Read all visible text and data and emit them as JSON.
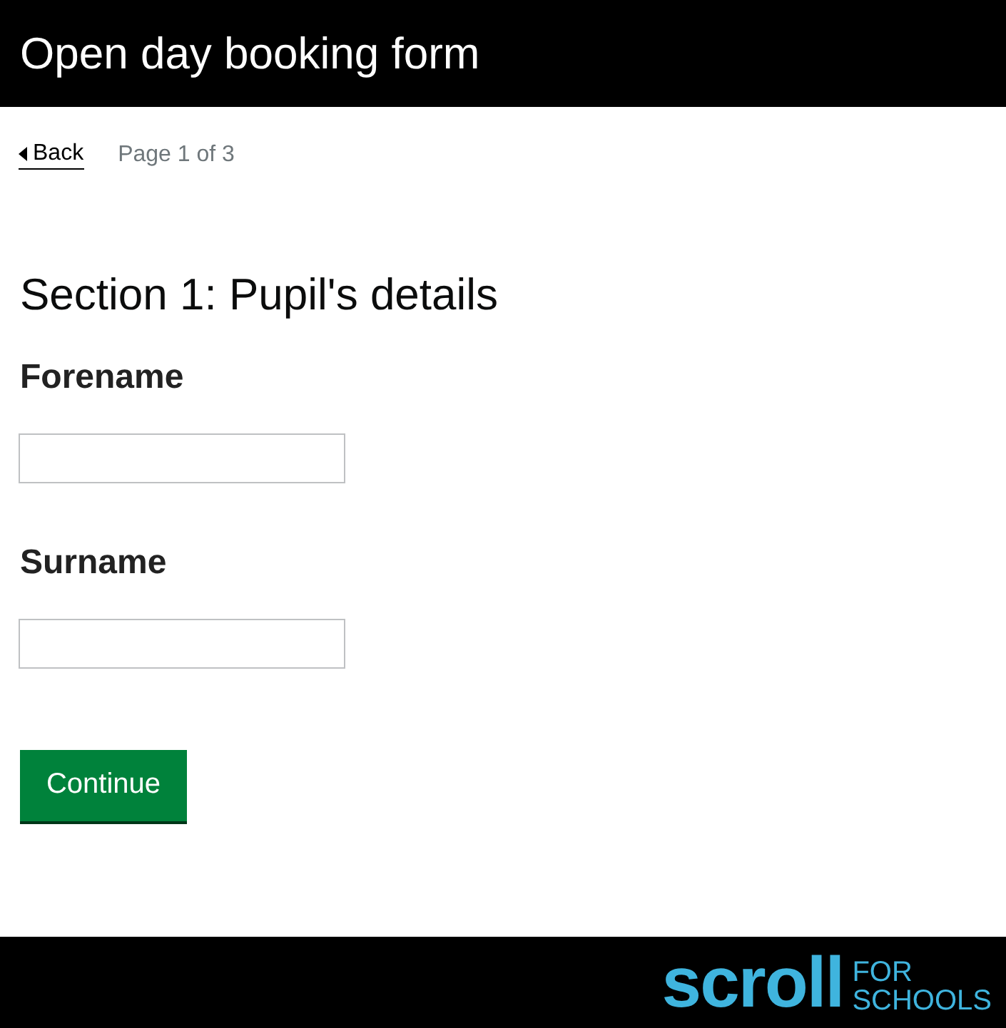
{
  "header": {
    "title": "Open day booking form"
  },
  "nav": {
    "back": "Back",
    "page": "Page 1 of 3"
  },
  "section_title": "Section 1: Pupil's details",
  "fields": [
    {
      "label": "Forename"
    },
    {
      "label": "Surname"
    }
  ],
  "button": "Continue",
  "footer": {
    "logo": "scroll",
    "logo_sub_1": "FOR",
    "logo_sub_2": "SCHOOLS"
  }
}
